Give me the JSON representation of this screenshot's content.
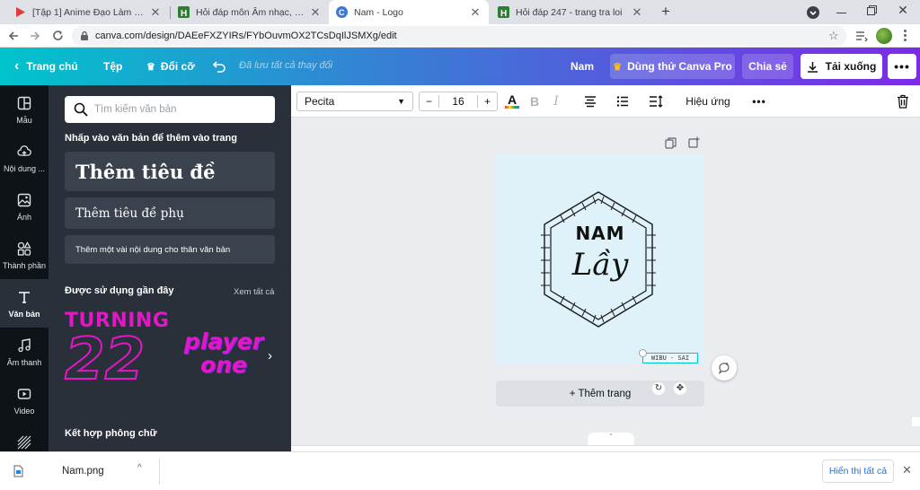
{
  "browser": {
    "tabs": [
      {
        "title": "[Tập 1] Anime Đạo Làm Chồng Đ",
        "icon": "play-triangle-icon"
      },
      {
        "title": "Hỏi đáp môn Âm nhạc, Mỹ thuật",
        "icon": "hoidap-h-icon"
      },
      {
        "title": "Nam - Logo",
        "icon": "canva-c-icon"
      },
      {
        "title": "Hỏi đáp 247 - trang tra loi",
        "icon": "hoidap-h-icon"
      }
    ],
    "url": "canva.com/design/DAEeFXZYIRs/FYbOuvmOX2TCsDqIlJSMXg/edit"
  },
  "header": {
    "home": "Trang chủ",
    "file": "Tệp",
    "resize": "Đổi cỡ",
    "saved_status": "Đã lưu tất cả thay đổi",
    "username": "Nam",
    "try_pro": "Dùng thử Canva Pro",
    "share": "Chia sẻ",
    "download": "Tải xuống"
  },
  "rail": [
    {
      "label": "Mẫu",
      "icon": "template-icon"
    },
    {
      "label": "Nội dung ...",
      "icon": "upload-cloud-icon"
    },
    {
      "label": "Ảnh",
      "icon": "photo-icon"
    },
    {
      "label": "Thành phần",
      "icon": "elements-icon"
    },
    {
      "label": "Văn bản",
      "icon": "text-t-icon"
    },
    {
      "label": "Âm thanh",
      "icon": "music-note-icon"
    },
    {
      "label": "Video",
      "icon": "video-icon"
    },
    {
      "label": "",
      "icon": "pattern-icon"
    }
  ],
  "panel": {
    "search_placeholder": "Tìm kiếm văn bản",
    "click_hint": "Nhấp vào văn bản để thêm vào trang",
    "add_heading": "Thêm tiêu đề",
    "add_subheading": "Thêm tiêu đề phụ",
    "add_body": "Thêm một vài nội dung cho thân văn bản",
    "recent_title": "Được sử dụng gần đây",
    "see_all": "Xem tất cả",
    "preview1_line1": "TURNING",
    "preview1_line2": "22",
    "preview2_line1": "player",
    "preview2_line2": "one",
    "font_combos": "Kết hợp phông chữ"
  },
  "toolbar": {
    "font": "Pecita",
    "font_size": "16",
    "effects": "Hiệu ứng"
  },
  "design": {
    "line1": "NAM",
    "line2": "Lầy",
    "tag": "WIBU - SAI",
    "add_page": "+ Thêm trang",
    "colors": {
      "page_bg": "#dff1f9",
      "selection": "#00c4cc"
    }
  },
  "downloads": {
    "file": "Nam.png",
    "show_all": "Hiển thị tất cả"
  },
  "colors": {
    "canva_purple": "#7d2ae8",
    "canva_teal": "#00c4cc",
    "panel_bg": "#293039",
    "rail_bg": "#0e1318",
    "preview_pink": "#e316c8"
  }
}
